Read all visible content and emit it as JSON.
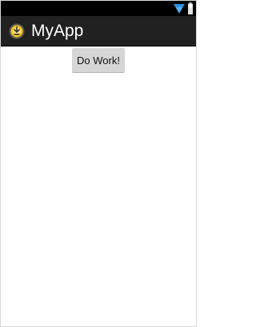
{
  "status_bar": {
    "icons": [
      "wifi-icon",
      "battery-icon"
    ],
    "color_background": "#000000"
  },
  "action_bar": {
    "app_icon": "app-launcher-icon",
    "title": "MyApp",
    "color_background": "#212121"
  },
  "main": {
    "do_work_label": "Do Work!"
  }
}
